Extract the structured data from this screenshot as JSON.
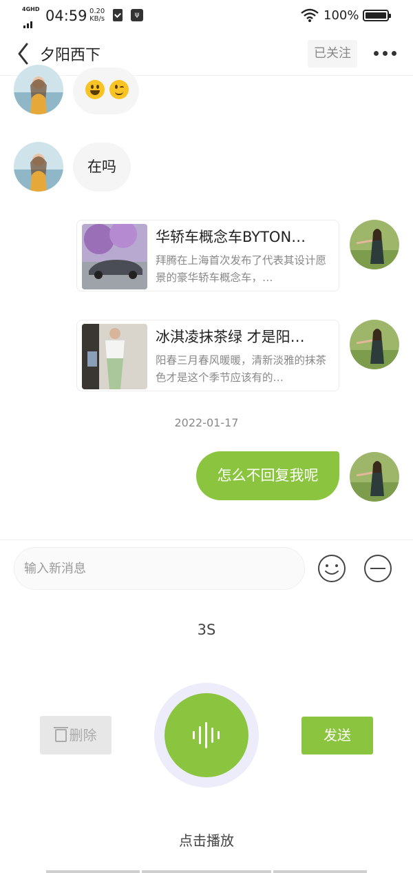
{
  "status_bar": {
    "network": "4GHD",
    "time": "04:59",
    "speed_value": "0.20",
    "speed_unit": "KB/s",
    "battery": "100%"
  },
  "header": {
    "title": "夕阳西下",
    "follow_label": "已关注"
  },
  "messages": [
    {
      "side": "left",
      "type": "emoji",
      "emojis": [
        "grinning-face-emoji",
        "winking-face-emoji"
      ]
    },
    {
      "side": "left",
      "type": "text",
      "text": "在吗"
    },
    {
      "side": "right",
      "type": "card",
      "title": "华轿车概念车BYTON…",
      "desc": "拜腾在上海首次发布了代表其设计愿景的豪华轿车概念车，…"
    },
    {
      "side": "right",
      "type": "card",
      "title": "冰淇凌抹茶绿 才是阳…",
      "desc": "阳春三月春风暖暖，清新淡雅的抹茶色才是这个季节应该有的…"
    },
    {
      "side": "right",
      "type": "text",
      "text": "怎么不回复我呢"
    }
  ],
  "date_separator": "2022-01-17",
  "input": {
    "placeholder": "输入新消息"
  },
  "voice": {
    "duration": "3S",
    "delete_label": "删除",
    "send_label": "发送",
    "play_hint": "点击播放"
  },
  "colors": {
    "accent": "#8bc53f",
    "bubble_gray": "#f5f5f5",
    "ring": "#ececfa"
  }
}
